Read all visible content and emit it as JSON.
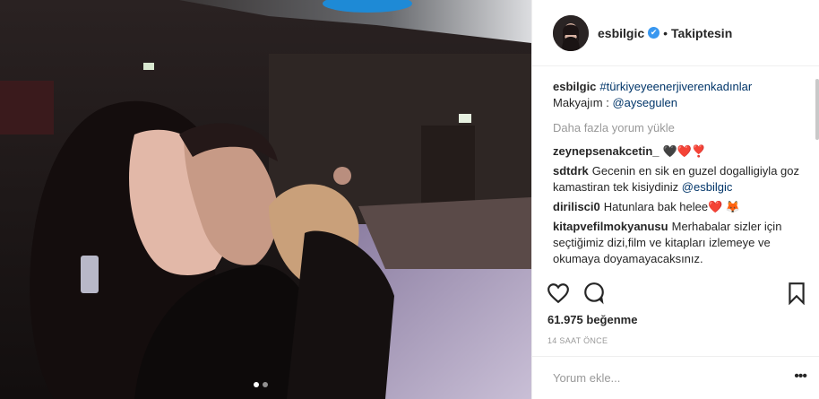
{
  "post": {
    "username": "esbilgic",
    "follow_status": "Takiptesin",
    "separator": "•",
    "verified_glyph": "✔",
    "caption": {
      "user": "esbilgic",
      "hashtag": "#türkiyeyeenerjiverenkadınlar",
      "makeup_prefix": "Makyajım : ",
      "makeup_mention": "@aysegulen"
    },
    "load_more": "Daha fazla yorum yükle",
    "comments": [
      {
        "user": "zeynepsenakcetin_",
        "text": "🖤❤️❣️"
      },
      {
        "user": "sdtdrk",
        "text": "Gecenin en sik en guzel dogalligiyla goz kamastiran tek kisiydiniz",
        "mention": "@esbilgic"
      },
      {
        "user": "dirilisci0",
        "text": "Hatunlara bak helee❤️ 🦊"
      },
      {
        "user": "kitapvefilmokyanusu",
        "text": "Merhabalar sizler için seçtiğimiz dizi,film ve kitapları izlemeye ve okumaya doyamayacaksınız."
      }
    ],
    "likes": "61.975 beğenme",
    "timestamp": "14 SAAT ÖNCE",
    "comment_placeholder": "Yorum ekle...",
    "more_glyph": "•••",
    "carousel": {
      "count": 2,
      "active": 0
    },
    "icons": [
      "heart-icon",
      "comment-icon",
      "bookmark-icon",
      "verified-badge-icon",
      "more-options-icon"
    ],
    "colors": {
      "verified": "#3897f0",
      "link": "#003569",
      "muted": "#999999",
      "text": "#262626"
    }
  }
}
